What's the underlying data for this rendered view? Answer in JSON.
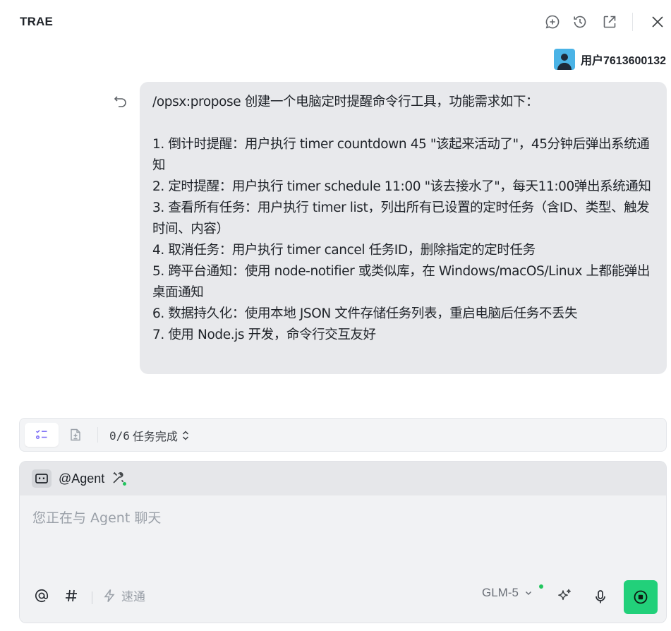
{
  "header": {
    "title": "TRAE",
    "icons": [
      "new-chat-icon",
      "history-icon",
      "open-external-icon",
      "close-icon"
    ]
  },
  "user": {
    "name": "用户7613600132",
    "avatar_color": "#4ab3e6"
  },
  "message": {
    "lines": [
      "/opsx:propose 创建一个电脑定时提醒命令行工具，功能需求如下：",
      "",
      "1. 倒计时提醒：用户执行 timer countdown 45 \"该起来活动了\"，45分钟后弹出系统通知",
      "2. 定时提醒：用户执行 timer schedule 11:00 \"该去接水了\"，每天11:00弹出系统通知",
      "3. 查看所有任务：用户执行 timer list，列出所有已设置的定时任务（含ID、类型、触发时间、内容）",
      "4. 取消任务：用户执行 timer cancel 任务ID，删除指定的定时任务",
      "5. 跨平台通知：使用 node-notifier 或类似库，在 Windows/macOS/Linux 上都能弹出桌面通知",
      "6. 数据持久化：使用本地 JSON 文件存储任务列表，重启电脑后任务不丢失",
      "7. 使用 Node.js 开发，命令行交互友好"
    ]
  },
  "tasks": {
    "count": "0/6",
    "label": "任务完成"
  },
  "composer": {
    "agent_label": "@Agent",
    "placeholder": "您正在与 Agent 聊天",
    "value": "",
    "mode_label": "速通",
    "model": "GLM-5"
  },
  "colors": {
    "accent_green": "#22d07a",
    "status_dot": "#22c55e",
    "bubble_bg": "#e8e9ec",
    "active_tab_icon": "#7b6cf6"
  }
}
